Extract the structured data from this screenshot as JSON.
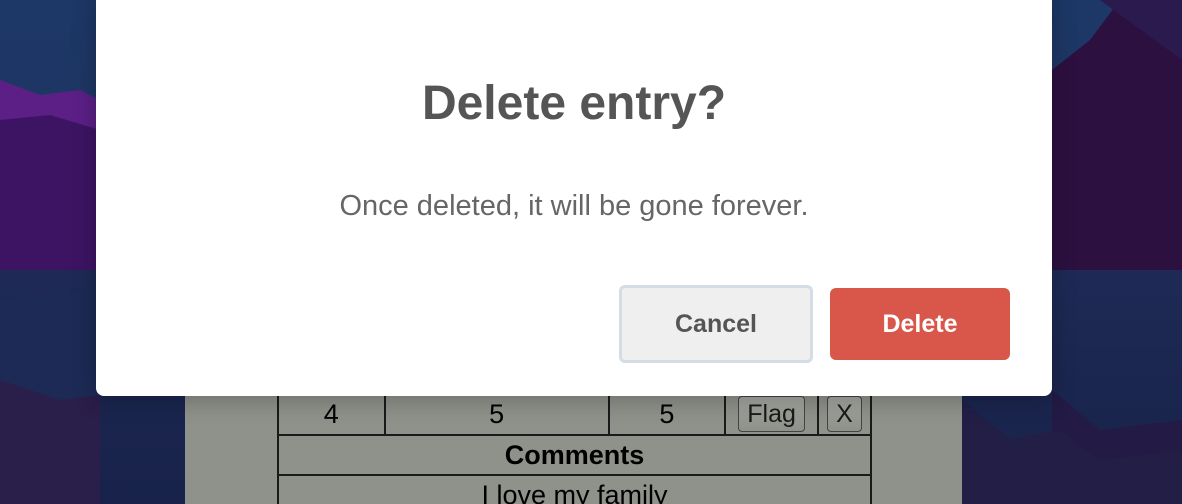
{
  "modal": {
    "title": "Delete entry?",
    "message": "Once deleted, it will be gone forever.",
    "cancel_label": "Cancel",
    "delete_label": "Delete"
  },
  "table": {
    "row": [
      "4",
      "5",
      "5"
    ],
    "flag_label": "Flag",
    "remove_label": "X",
    "comments_header": "Comments",
    "comment": "I love my family"
  },
  "colors": {
    "danger": "#d9564b",
    "title_text": "#555555",
    "body_text": "#666666",
    "cancel_bg": "#efefef"
  }
}
